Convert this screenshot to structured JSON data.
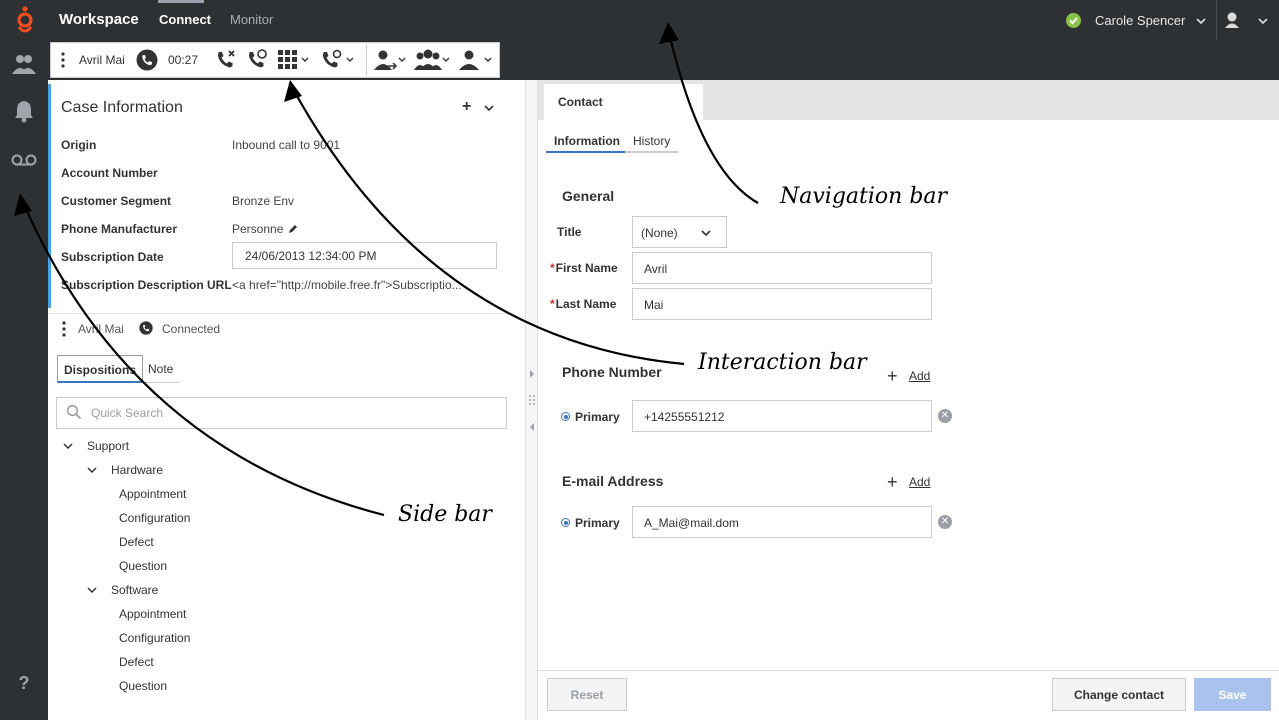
{
  "topnav": {
    "app_title": "Workspace",
    "tabs": [
      "Connect",
      "Monitor"
    ],
    "user_name": "Carole Spencer",
    "status_color": "#8bc34a"
  },
  "interaction_bar": {
    "contact": "Avril Mai",
    "timer": "00:27"
  },
  "case_info": {
    "title": "Case Information",
    "rows": [
      {
        "label": "Origin",
        "value": "Inbound call to 9001"
      },
      {
        "label": "Account Number",
        "value": ""
      },
      {
        "label": "Customer Segment",
        "value": "Bronze Env"
      },
      {
        "label": "Phone Manufacturer",
        "value": "Personne"
      },
      {
        "label": "Subscription Date",
        "value": "24/06/2013 12:34:00 PM"
      },
      {
        "label": "Subscription Description URL",
        "value": "<a href=\"http://mobile.free.fr\">Subscriptio..."
      }
    ]
  },
  "connection": {
    "name": "Avril Mai",
    "status": "Connected"
  },
  "subtabs": {
    "dispositions": "Dispositions",
    "note": "Note"
  },
  "search": {
    "placeholder": "Quick Search"
  },
  "tree": {
    "root": "Support",
    "groups": [
      {
        "name": "Hardware",
        "items": [
          "Appointment",
          "Configuration",
          "Defect",
          "Question"
        ]
      },
      {
        "name": "Software",
        "items": [
          "Appointment",
          "Configuration",
          "Defect",
          "Question"
        ]
      }
    ]
  },
  "contact": {
    "tab": "Contact",
    "subtabs": [
      "Information",
      "History"
    ],
    "general": "General",
    "title_label": "Title",
    "title_value": "(None)",
    "first_name_label": "First Name",
    "first_name": "Avril",
    "last_name_label": "Last Name",
    "last_name": "Mai",
    "phone_section": "Phone Number",
    "phone_type": "Primary",
    "phone": "+14255551212",
    "email_section": "E-mail Address",
    "email_type": "Primary",
    "email": "A_Mai@mail.dom",
    "add_label": "Add"
  },
  "footer": {
    "reset": "Reset",
    "change_contact": "Change contact",
    "save": "Save"
  },
  "annotations": {
    "navigation": "Navigation bar",
    "interaction": "Interaction bar",
    "side": "Side bar"
  }
}
